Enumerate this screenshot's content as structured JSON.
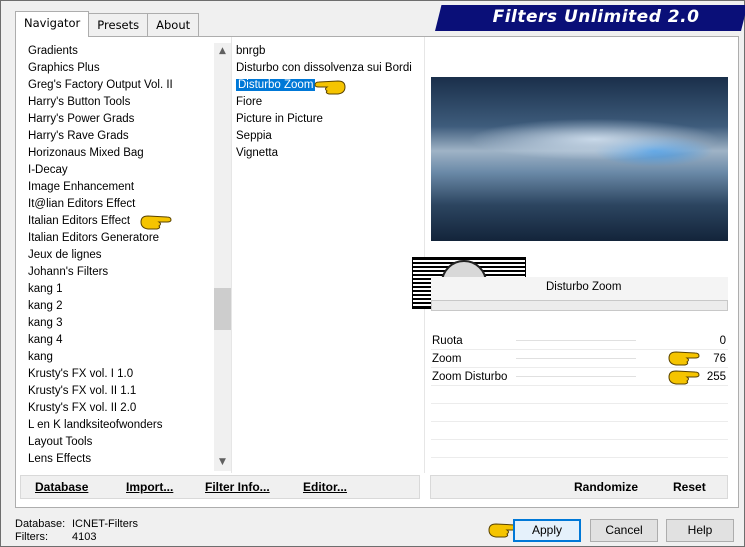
{
  "title": "Filters Unlimited 2.0",
  "tabs": [
    "Navigator",
    "Presets",
    "About"
  ],
  "categories": [
    "Gradients",
    "Graphics Plus",
    "Greg's Factory Output Vol. II",
    "Harry's Button Tools",
    "Harry's Power Grads",
    "Harry's Rave Grads",
    "Horizonaus Mixed Bag",
    "I-Decay",
    "Image Enhancement",
    "It@lian Editors Effect",
    "Italian Editors Effect",
    "Italian Editors Generatore",
    "Jeux de lignes",
    "Johann's Filters",
    "kang 1",
    "kang 2",
    "kang 3",
    "kang 4",
    "kang",
    "Krusty's FX vol. I 1.0",
    "Krusty's FX vol. II 1.1",
    "Krusty's FX vol. II 2.0",
    "L en K landksiteofwonders",
    "Layout Tools",
    "Lens Effects"
  ],
  "selected_category": "Italian Editors Effect",
  "filters": [
    "bnrgb",
    "Disturbo con dissolvenza sui Bordi",
    "Disturbo Zoom",
    "Fiore",
    "Picture in Picture",
    "Seppia",
    "Vignetta"
  ],
  "selected_filter": "Disturbo Zoom",
  "filter_title": "Disturbo Zoom",
  "watermark_text": "claudia",
  "params": [
    {
      "label": "Ruota",
      "value": "0"
    },
    {
      "label": "Zoom",
      "value": "76"
    },
    {
      "label": "Zoom Disturbo",
      "value": "255"
    }
  ],
  "toolbar": {
    "database": "Database",
    "import": "Import...",
    "filter_info": "Filter Info...",
    "editor": "Editor...",
    "randomize": "Randomize",
    "reset": "Reset"
  },
  "status": {
    "database_label": "Database:",
    "database_value": "ICNET-Filters",
    "filters_label": "Filters:",
    "filters_value": "4103"
  },
  "buttons": {
    "apply": "Apply",
    "cancel": "Cancel",
    "help": "Help"
  },
  "colors": {
    "banner": "#0a0f78",
    "selection": "#0078d7",
    "pointer_hand": "#f5c400"
  },
  "scrollbar": {
    "position_fraction": 0.6
  }
}
